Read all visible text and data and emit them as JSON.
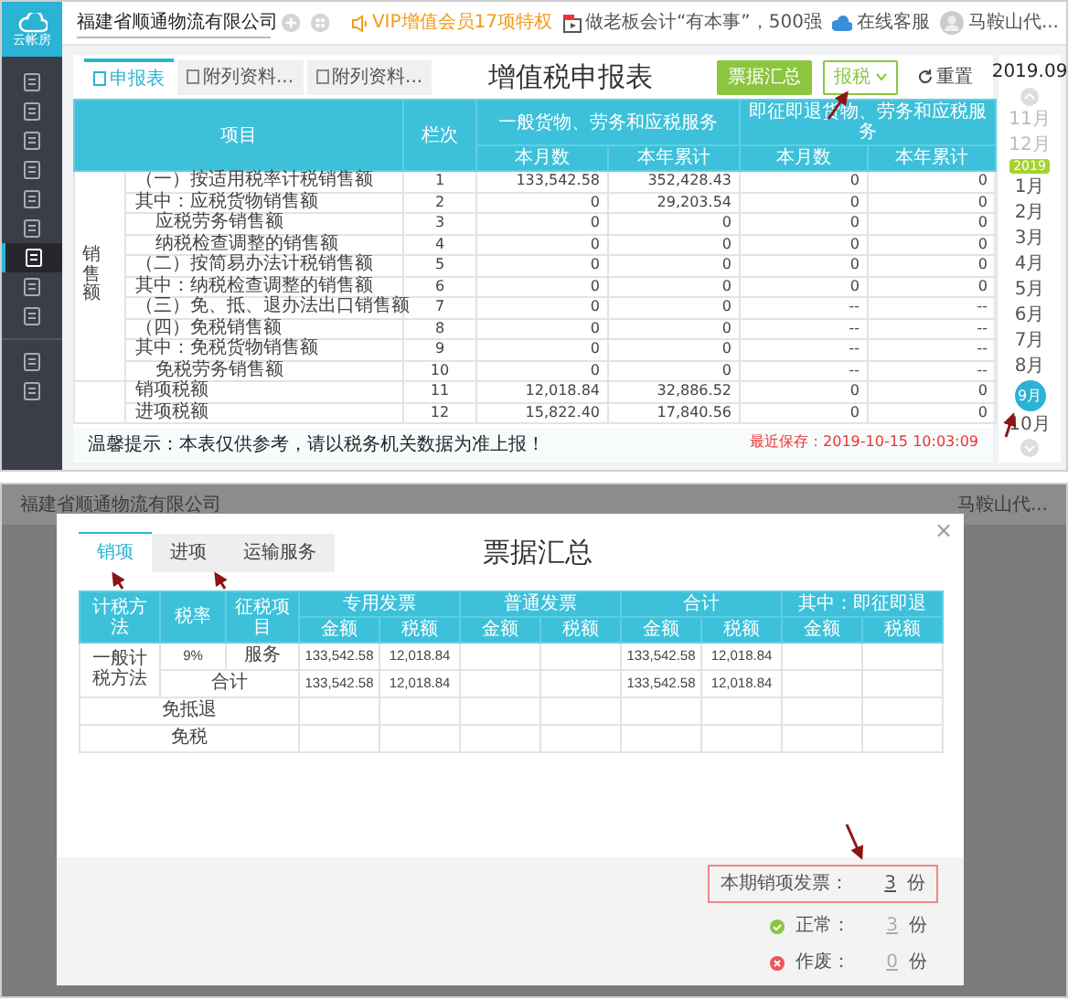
{
  "top_screen": {
    "logo": {
      "label": "云帐房"
    },
    "sidebar": {
      "items": [
        {
          "selected": false
        },
        {
          "selected": false
        },
        {
          "selected": false
        },
        {
          "selected": false
        },
        {
          "selected": false
        },
        {
          "selected": false
        },
        {
          "selected": true
        },
        {
          "selected": false
        },
        {
          "selected": false
        },
        {
          "selected": false
        },
        {
          "selected": false
        }
      ]
    },
    "company_select": {
      "value": "福建省顺通物流有限公司"
    },
    "header_links": [
      {
        "kind": "vip",
        "text": "VIP增值会员17项特权"
      },
      {
        "kind": "promo",
        "text": "做老板会计“有本事”，500强"
      },
      {
        "kind": "service",
        "text": "在线客服"
      }
    ],
    "user": {
      "name": "马鞍山代..."
    },
    "tabs": [
      {
        "label": "申报表",
        "selected": true
      },
      {
        "label": "附列资料...",
        "selected": false
      },
      {
        "label": "附列资料...",
        "selected": false
      }
    ],
    "title": "增值税申报表",
    "buttons": [
      {
        "kind": "primary",
        "label": "票据汇总"
      },
      {
        "kind": "dropdown",
        "label": "报税"
      },
      {
        "kind": "refresh",
        "label": "重置"
      }
    ],
    "table": {
      "columns": {
        "item": "项目",
        "line": "栏次",
        "group_1": "一般货物、劳务和应税服务",
        "group_2": "即征即退货物、劳务和应税服务",
        "sub": [
          "本月数",
          "本年累计",
          "本月数",
          "本年累计"
        ]
      },
      "groups": [
        {
          "label": "销售额",
          "rows": [
            {
              "kind": "main",
              "item": "（一）按适用税率计税销售额",
              "line": "1",
              "values": [
                "133,542.58",
                "352,428.43",
                "0",
                "0"
              ]
            },
            {
              "kind": "main",
              "item": "其中：应税货物销售额",
              "line": "2",
              "values": [
                "0",
                "29,203.54",
                "0",
                "0"
              ]
            },
            {
              "kind": "sub",
              "item": "应税劳务销售额",
              "line": "3",
              "values": [
                "0",
                "0",
                "0",
                "0"
              ]
            },
            {
              "kind": "sub",
              "item": "纳税检查调整的销售额",
              "line": "4",
              "values": [
                "0",
                "0",
                "0",
                "0"
              ]
            },
            {
              "kind": "main",
              "item": "（二）按简易办法计税销售额",
              "line": "5",
              "values": [
                "0",
                "0",
                "0",
                "0"
              ]
            },
            {
              "kind": "main",
              "item": "其中：纳税检查调整的销售额",
              "line": "6",
              "values": [
                "0",
                "0",
                "0",
                "0"
              ]
            },
            {
              "kind": "main",
              "item": "（三）免、抵、退办法出口销售额",
              "line": "7",
              "values": [
                "0",
                "0",
                "--",
                "--"
              ]
            },
            {
              "kind": "main",
              "item": "（四）免税销售额",
              "line": "8",
              "values": [
                "0",
                "0",
                "--",
                "--"
              ]
            },
            {
              "kind": "main",
              "item": "其中：免税货物销售额",
              "line": "9",
              "values": [
                "0",
                "0",
                "--",
                "--"
              ]
            },
            {
              "kind": "sub",
              "item": "免税劳务销售额",
              "line": "10",
              "values": [
                "0",
                "0",
                "--",
                "--"
              ]
            }
          ]
        },
        {
          "rows": [
            {
              "kind": "main",
              "item": "销项税额",
              "line": "11",
              "values": [
                "12,018.84",
                "32,886.52",
                "0",
                "0"
              ]
            },
            {
              "kind": "main",
              "item": "进项税额",
              "line": "12",
              "values": [
                "15,822.40",
                "17,840.56",
                "0",
                "0"
              ]
            }
          ]
        }
      ]
    },
    "notice": "温馨提示：本表仅供参考，请以税务机关数据为准上报！",
    "last_saved": "最近保存：2019-10-15 10:03:09",
    "month_picker": {
      "period": "2019.09",
      "year_badge": "2019",
      "months": [
        {
          "label": "11月",
          "disabled": true,
          "selected": false
        },
        {
          "label": "12月",
          "disabled": true,
          "selected": false
        },
        {
          "label": "1月",
          "disabled": false,
          "selected": false
        },
        {
          "label": "2月",
          "disabled": false,
          "selected": false
        },
        {
          "label": "3月",
          "disabled": false,
          "selected": false
        },
        {
          "label": "4月",
          "disabled": false,
          "selected": false
        },
        {
          "label": "5月",
          "disabled": false,
          "selected": false
        },
        {
          "label": "6月",
          "disabled": false,
          "selected": false
        },
        {
          "label": "7月",
          "disabled": false,
          "selected": false
        },
        {
          "label": "8月",
          "disabled": false,
          "selected": false
        },
        {
          "label": "9月",
          "disabled": false,
          "selected": true
        },
        {
          "label": "10月",
          "disabled": false,
          "selected": false
        }
      ]
    }
  },
  "bottom_screen": {
    "background": {
      "company": "福建省顺通物流有限公司",
      "user": "马鞍山代..."
    },
    "dialog": {
      "title": "票据汇总",
      "close_label": "×",
      "tabs": [
        {
          "label": "销项",
          "selected": true
        },
        {
          "label": "进项",
          "selected": false
        },
        {
          "label": "运输服务",
          "selected": false
        }
      ],
      "table": {
        "columns": [
          "计税方法",
          "税率",
          "征税项目"
        ],
        "groups": [
          {
            "label": "专用发票",
            "sub": [
              "金额",
              "税额"
            ]
          },
          {
            "label": "普通发票",
            "sub": [
              "金额",
              "税额"
            ]
          },
          {
            "label": "合计",
            "sub": [
              "金额",
              "税额"
            ]
          },
          {
            "label": "其中：即征即退",
            "sub": [
              "金额",
              "税额"
            ]
          }
        ],
        "rows": [
          {
            "kind": "rate",
            "method": "一般计税方法",
            "rate": "9%",
            "item": "服务",
            "values": {
              "special_amount": "133,542.58",
              "special_tax": "12,018.84",
              "total_amount": "133,542.58",
              "total_tax": "12,018.84"
            }
          },
          {
            "kind": "subtotal",
            "label": "合计",
            "values": {
              "special_amount": "133,542.58",
              "special_tax": "12,018.84",
              "total_amount": "133,542.58",
              "total_tax": "12,018.84"
            }
          },
          {
            "kind": "other",
            "label": "免抵退"
          },
          {
            "kind": "other",
            "label": "免税"
          }
        ]
      },
      "summary": [
        {
          "kind": "total",
          "label": "本期销项发票：",
          "count": "3",
          "unit": "份"
        },
        {
          "kind": "normal",
          "label": "正常：",
          "count": "3",
          "unit": "份"
        },
        {
          "kind": "void",
          "label": "作废：",
          "count": "0",
          "unit": "份"
        }
      ]
    }
  }
}
